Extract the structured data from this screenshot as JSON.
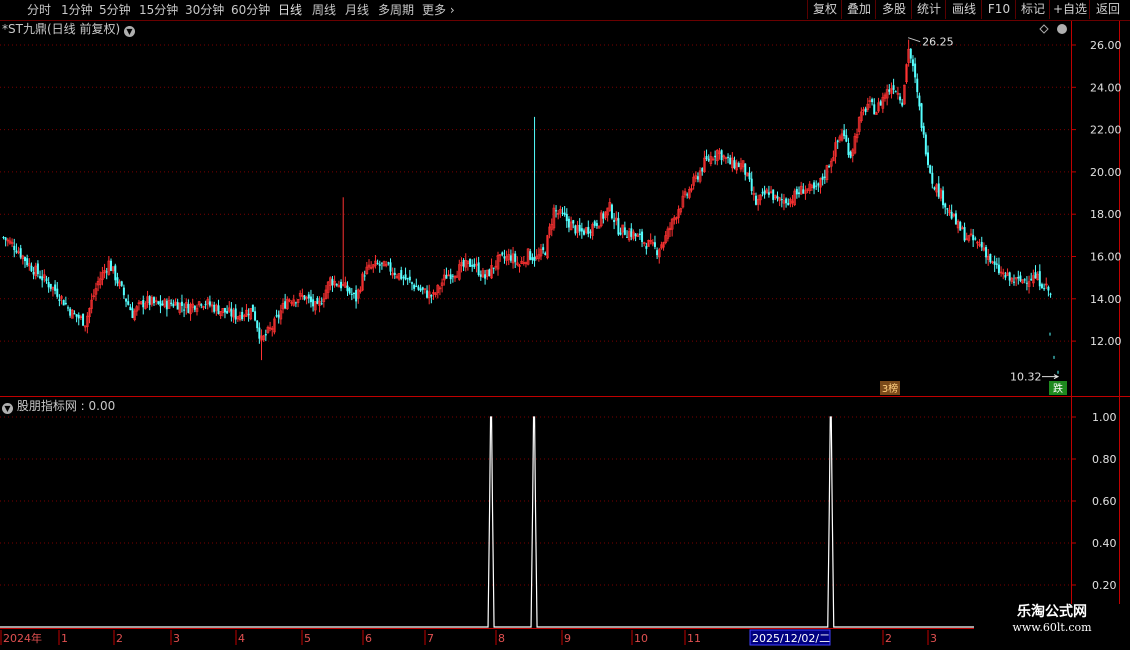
{
  "toolbar": {
    "timeframes": [
      {
        "label": "分时",
        "active": false
      },
      {
        "label": "1分钟",
        "active": false
      },
      {
        "label": "5分钟",
        "active": false
      },
      {
        "label": "15分钟",
        "active": false
      },
      {
        "label": "30分钟",
        "active": false
      },
      {
        "label": "60分钟",
        "active": false
      },
      {
        "label": "日线",
        "active": true
      },
      {
        "label": "周线",
        "active": false
      },
      {
        "label": "月线",
        "active": false
      },
      {
        "label": "多周期",
        "active": false
      },
      {
        "label": "更多",
        "active": false
      }
    ],
    "buttons": [
      "复权",
      "叠加",
      "多股",
      "统计",
      "画线",
      "F10",
      "标记",
      "+自选",
      "返回"
    ]
  },
  "main_chart": {
    "title": "*ST九鼎(日线 前复权)",
    "high_label": "26.25",
    "low_label": "10.32",
    "badge_left": "3榜",
    "badge_right": "跌"
  },
  "sub_chart": {
    "title": "股朋指标网 : 0.00"
  },
  "time_axis": {
    "labels": [
      "2024年",
      "1",
      "2",
      "3",
      "4",
      "5",
      "6",
      "7",
      "8",
      "9",
      "10",
      "11",
      "2025/12/02/二",
      "2",
      "3"
    ]
  },
  "watermark": {
    "line1": "乐淘公式网",
    "line2": "www.60lt.com"
  },
  "colors": {
    "up": "#ff3232",
    "down": "#54ffff",
    "grid": "#7a0000",
    "axis": "#c00000",
    "signal": "#ffffff"
  },
  "chart_data": [
    {
      "type": "candlestick",
      "title": "*ST九鼎(日线 前复权)",
      "ylim": [
        10.0,
        26.8
      ],
      "y_ticks": [
        "26.00",
        "24.00",
        "22.00",
        "20.00",
        "18.00",
        "16.00",
        "14.00",
        "12.00"
      ],
      "annotations": {
        "max": 26.25,
        "min": 10.32
      },
      "close_path": [
        [
          0,
          16.9
        ],
        [
          6,
          16.4
        ],
        [
          12,
          15.6
        ],
        [
          18,
          15.0
        ],
        [
          25,
          14.3
        ],
        [
          32,
          13.3
        ],
        [
          38,
          12.9
        ],
        [
          44,
          14.8
        ],
        [
          49,
          15.7
        ],
        [
          55,
          14.4
        ],
        [
          60,
          13.3
        ],
        [
          66,
          13.9
        ],
        [
          72,
          13.7
        ],
        [
          80,
          13.8
        ],
        [
          86,
          13.6
        ],
        [
          92,
          13.9
        ],
        [
          100,
          13.5
        ],
        [
          108,
          13.2
        ],
        [
          116,
          13.5
        ],
        [
          120,
          12.0
        ],
        [
          126,
          12.8
        ],
        [
          132,
          14.0
        ],
        [
          140,
          14.1
        ],
        [
          146,
          13.5
        ],
        [
          152,
          14.9
        ],
        [
          158,
          14.6
        ],
        [
          164,
          14.0
        ],
        [
          168,
          15.3
        ],
        [
          174,
          15.6
        ],
        [
          180,
          15.4
        ],
        [
          186,
          15.0
        ],
        [
          194,
          14.4
        ],
        [
          200,
          14.1
        ],
        [
          206,
          15.1
        ],
        [
          212,
          15.4
        ],
        [
          218,
          15.7
        ],
        [
          224,
          15.0
        ],
        [
          230,
          15.8
        ],
        [
          236,
          16.0
        ],
        [
          240,
          15.6
        ],
        [
          244,
          16.1
        ],
        [
          248,
          15.9
        ],
        [
          252,
          16.3
        ],
        [
          256,
          18.2
        ],
        [
          260,
          17.9
        ],
        [
          264,
          17.5
        ],
        [
          268,
          17.1
        ],
        [
          272,
          17.3
        ],
        [
          278,
          17.8
        ],
        [
          282,
          18.3
        ],
        [
          286,
          17.3
        ],
        [
          292,
          17.1
        ],
        [
          298,
          16.7
        ],
        [
          304,
          16.3
        ],
        [
          308,
          16.9
        ],
        [
          314,
          18.3
        ],
        [
          320,
          19.3
        ],
        [
          326,
          20.4
        ],
        [
          332,
          21.0
        ],
        [
          338,
          20.4
        ],
        [
          344,
          20.3
        ],
        [
          350,
          18.5
        ],
        [
          356,
          19.1
        ],
        [
          360,
          18.6
        ],
        [
          366,
          18.7
        ],
        [
          372,
          19.2
        ],
        [
          378,
          19.1
        ],
        [
          382,
          19.9
        ],
        [
          386,
          20.9
        ],
        [
          390,
          21.9
        ],
        [
          394,
          20.8
        ],
        [
          398,
          22.4
        ],
        [
          402,
          23.2
        ],
        [
          406,
          22.9
        ],
        [
          410,
          23.7
        ],
        [
          414,
          24.1
        ],
        [
          418,
          23.4
        ],
        [
          421,
          25.9
        ],
        [
          424,
          24.3
        ],
        [
          428,
          21.6
        ],
        [
          432,
          19.6
        ],
        [
          436,
          18.9
        ],
        [
          440,
          18.1
        ],
        [
          444,
          17.4
        ],
        [
          448,
          16.9
        ],
        [
          452,
          16.7
        ],
        [
          456,
          16.4
        ],
        [
          460,
          15.6
        ],
        [
          464,
          15.2
        ],
        [
          468,
          14.9
        ],
        [
          472,
          14.8
        ],
        [
          476,
          15.0
        ],
        [
          480,
          15.0
        ],
        [
          484,
          14.7
        ],
        [
          487,
          14.2
        ]
      ]
    },
    {
      "type": "line",
      "title": "股朋指标网 : 0.00",
      "ylim": [
        0,
        1.0
      ],
      "y_ticks": [
        "1.00",
        "0.80",
        "0.60",
        "0.40",
        "0.20"
      ],
      "signal_indices": [
        227,
        247,
        385
      ]
    }
  ]
}
